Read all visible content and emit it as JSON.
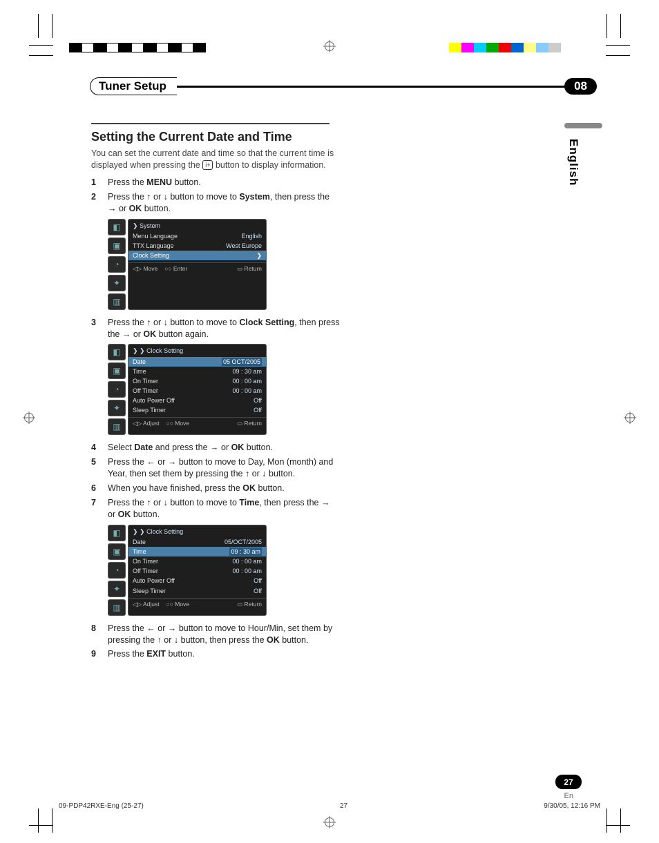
{
  "header": {
    "title": "Tuner Setup",
    "chapter": "08"
  },
  "lang_tab": "English",
  "page": {
    "num": "27",
    "lang": "En"
  },
  "footer": {
    "file": "09-PDP42RXE-Eng (25-27)",
    "pg": "27",
    "stamp": "9/30/05, 12:16 PM"
  },
  "section": {
    "heading": "Setting the Current Date and Time",
    "intro_a": "You can set the current date and time so that the current time is displayed when pressing the ",
    "intro_btn": "i+",
    "intro_b": " button to display information."
  },
  "steps": {
    "s1": {
      "n": "1",
      "a": "Press the ",
      "b": "MENU",
      "c": " button."
    },
    "s2": {
      "n": "2",
      "a": "Press the ",
      "b": " or ",
      "c": " button to move to ",
      "d": "System",
      "e": ", then press the ",
      "f": " or ",
      "g": "OK",
      "h": " button."
    },
    "s3": {
      "n": "3",
      "a": "Press the ",
      "b": " or ",
      "c": " button to move to ",
      "d": "Clock Setting",
      "e": ", then press the ",
      "f": " or ",
      "g": "OK",
      "h": " button again."
    },
    "s4": {
      "n": "4",
      "a": "Select ",
      "b": "Date",
      "c": " and press the ",
      "d": " or ",
      "e": "OK",
      "f": " button."
    },
    "s5": {
      "n": "5",
      "a": "Press the ",
      "b": " or ",
      "c": " button to move to Day, Mon (month) and Year, then set them by pressing the ",
      "d": " or ",
      "e": " button."
    },
    "s6": {
      "n": "6",
      "a": "When you have finished, press the ",
      "b": "OK",
      "c": " button."
    },
    "s7": {
      "n": "7",
      "a": "Press the ",
      "b": " or ",
      "c": " button to move to ",
      "d": "Time",
      "e": ", then press the ",
      "f": " or ",
      "g": "OK",
      "h": " button."
    },
    "s8": {
      "n": "8",
      "a": "Press the ",
      "b": " or ",
      "c": " button to move to Hour/Min, set them by pressing the ",
      "d": " or ",
      "e": " button, then press the ",
      "f": "OK",
      "g": " button."
    },
    "s9": {
      "n": "9",
      "a": "Press the ",
      "b": "EXIT",
      "c": " button."
    }
  },
  "osd1": {
    "title": "System",
    "rows": [
      {
        "label": "Menu Language",
        "val": "English"
      },
      {
        "label": "TTX Language",
        "val": "West Europe"
      },
      {
        "label": "Clock Setting",
        "val": "❯",
        "hl": true
      }
    ],
    "footer": [
      "Move",
      "Enter",
      "Return"
    ]
  },
  "osd2": {
    "title": "Clock Setting",
    "rows": [
      {
        "label": "Date",
        "val": "05 OCT/2005",
        "hl": true,
        "boxed": true
      },
      {
        "label": "Time",
        "val": "09 : 30 am"
      },
      {
        "label": "On Timer",
        "val": "00 : 00 am"
      },
      {
        "label": "Off Timer",
        "val": "00 : 00 am"
      },
      {
        "label": "Auto Power Off",
        "val": "Off"
      },
      {
        "label": "Sleep Timer",
        "val": "Off"
      }
    ],
    "footer": [
      "Adjust",
      "Move",
      "Return"
    ]
  },
  "osd3": {
    "title": "Clock Setting",
    "rows": [
      {
        "label": "Date",
        "val": "05/OCT/2005"
      },
      {
        "label": "Time",
        "val": "09 : 30 am",
        "hl": true,
        "boxed": true
      },
      {
        "label": "On Timer",
        "val": "00 : 00 am"
      },
      {
        "label": "Off Timer",
        "val": "00 : 00 am"
      },
      {
        "label": "Auto Power Off",
        "val": "Off"
      },
      {
        "label": "Sleep Timer",
        "val": "Off"
      }
    ],
    "footer": [
      "Adjust",
      "Move",
      "Return"
    ]
  }
}
